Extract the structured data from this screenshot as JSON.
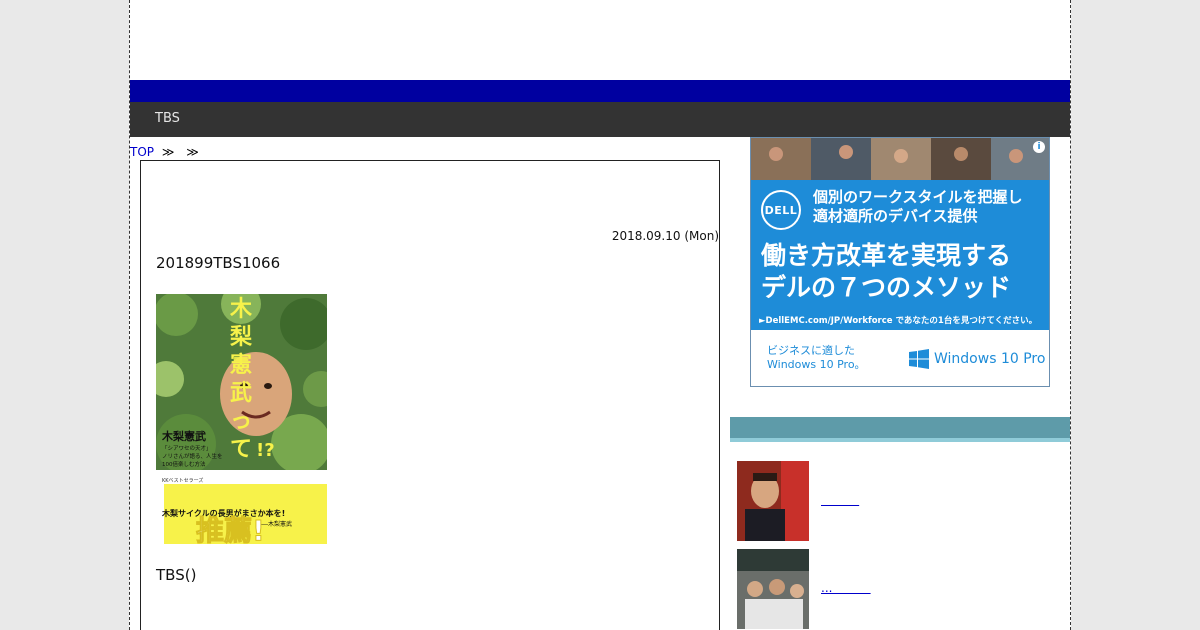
{
  "nav": {
    "items": [
      {
        "label": "TBS"
      }
    ]
  },
  "breadcrumb": {
    "top_label": "TOP",
    "separator": "≫"
  },
  "article": {
    "date": "2018.09.10 (Mon)",
    "title": "201899TBS1066",
    "book_cover": {
      "title_chars": [
        "木",
        "梨",
        "憲",
        "武",
        "っ",
        "て",
        "!?"
      ],
      "author": "木梨憲武",
      "tagline_lines": [
        "「シアワセの天才」",
        "ノリさんが語る、人生を",
        "100倍楽しむ方法"
      ],
      "publisher": "KKベストセラーズ",
      "obi_text": "木梨サイクルの長男がまさか本を!",
      "obi_author": "――木梨憲武",
      "obi_big": "推薦!"
    },
    "body_text": "TBS()"
  },
  "ad": {
    "brand": "DELL",
    "subhead_lines": [
      "個別のワークスタイルを把握し",
      "適材適所のデバイス提供"
    ],
    "headline_lines": [
      "働き方改革を実現する",
      "デルの７つのメソッド"
    ],
    "url_text": "►DellEMC.com/JP/Workforce であなたの1台を見つけてください。",
    "biz_lines": [
      "ビジネスに適した",
      "Windows 10 Pro。"
    ],
    "windows_label": "Windows 10 Pro",
    "info_symbol": "i",
    "colors": {
      "ad_blue": "#1e8cd8",
      "nav_blue": "#0000a0",
      "nav_dark": "#333333",
      "sidebar_teal": "#5e9ba9"
    }
  },
  "sidebar": {
    "items": [
      {
        "link_text": "          "
      },
      {
        "link_text": "...          "
      }
    ]
  }
}
